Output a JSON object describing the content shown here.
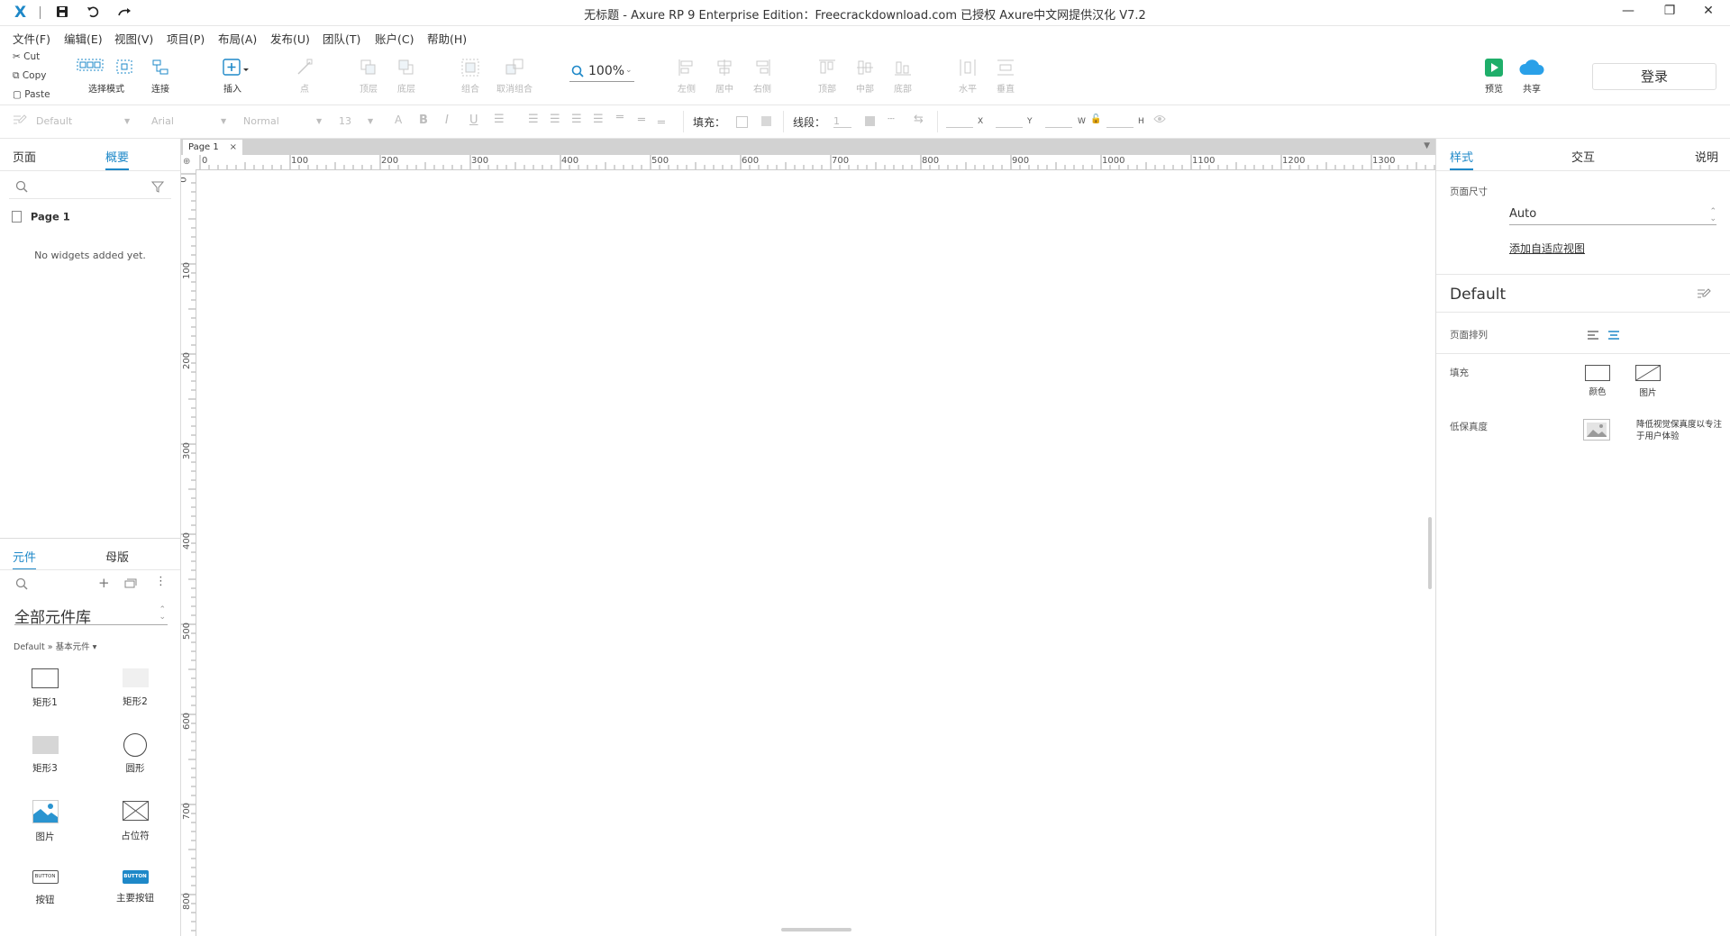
{
  "window": {
    "title": "无标题 - Axure RP 9 Enterprise Edition：Freecrackdownload.com 已授权    Axure中文网提供汉化 V7.2",
    "logo": "X",
    "minimize": "—",
    "restore": "❐",
    "close": "✕"
  },
  "menu": [
    "文件(F)",
    "编辑(E)",
    "视图(V)",
    "项目(P)",
    "布局(A)",
    "发布(U)",
    "团队(T)",
    "账户(C)",
    "帮助(H)"
  ],
  "clipboard": {
    "cut": "Cut",
    "copy": "Copy",
    "paste": "Paste"
  },
  "toolbar": {
    "select_mode": "选择模式",
    "connect": "连接",
    "insert": "插入",
    "point": "点",
    "top_layer": "顶层",
    "bottom_layer": "底层",
    "group": "组合",
    "ungroup": "取消组合",
    "zoom": "100%",
    "align_left": "左侧",
    "align_center": "居中",
    "align_right": "右侧",
    "align_top": "顶部",
    "align_middle": "中部",
    "align_bottom": "底部",
    "dist_horizontal": "水平",
    "dist_vertical": "垂直",
    "preview": "预览",
    "share": "共享",
    "login": "登录"
  },
  "format": {
    "style": "Default",
    "font": "Arial",
    "weight": "Normal",
    "size": "13",
    "fill_label": "填充：",
    "line_label": "线段：",
    "line_value": "1",
    "x": "X",
    "y": "Y",
    "w": "W",
    "h": "H"
  },
  "left": {
    "tab_pages": "页面",
    "tab_outline": "概要",
    "page_item": "Page 1",
    "empty_text": "No widgets added yet.",
    "tab_widgets": "元件",
    "tab_masters": "母版",
    "library": "全部元件库",
    "breadcrumb": "Default » 基本元件 ▾",
    "widgets": [
      {
        "label": "矩形1"
      },
      {
        "label": "矩形2"
      },
      {
        "label": "矩形3"
      },
      {
        "label": "圆形"
      },
      {
        "label": "图片"
      },
      {
        "label": "占位符"
      },
      {
        "label": "按钮"
      },
      {
        "label": "主要按钮"
      }
    ],
    "button_text": "BUTTON"
  },
  "canvas": {
    "doc_tab": "Page 1",
    "hticks": [
      "0",
      "100",
      "200",
      "300",
      "400",
      "500",
      "600",
      "700",
      "800",
      "900",
      "1000",
      "1100",
      "1200",
      "1300"
    ],
    "vticks": [
      "0",
      "100",
      "200",
      "300",
      "400",
      "500",
      "600",
      "700",
      "800"
    ]
  },
  "right": {
    "tab_style": "样式",
    "tab_interaction": "交互",
    "tab_notes": "说明",
    "page_size_label": "页面尺寸",
    "page_size_value": "Auto",
    "adaptive_link": "添加自适应视图",
    "default_title": "Default",
    "align_label": "页面排列",
    "fill_label": "填充",
    "fill_color": "颜色",
    "fill_image": "图片",
    "low_fidelity_label": "低保真度",
    "low_fidelity_desc": "降低视觉保真度以专注于用户体验"
  },
  "colors": {
    "accent": "#1e88c8",
    "preview_green": "#1fae6a",
    "share_blue": "#2aa0e8"
  }
}
